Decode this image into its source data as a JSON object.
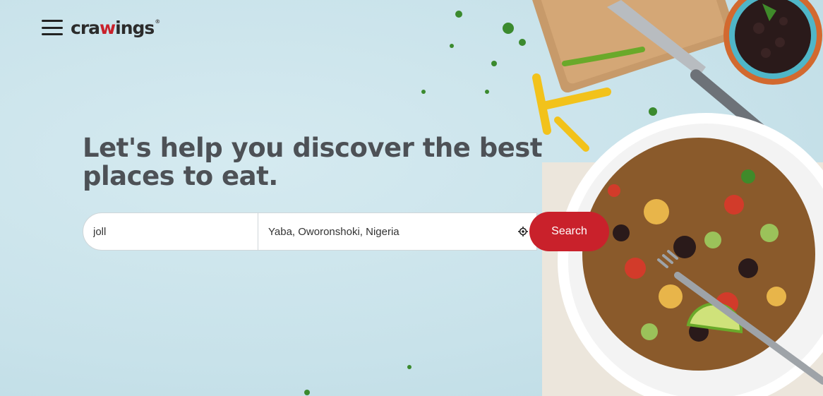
{
  "header": {
    "logo_prefix": "cra",
    "logo_accent": "w",
    "logo_suffix": "ings",
    "logo_mark": "®"
  },
  "hero": {
    "headline": "Let's help you discover the best places to eat."
  },
  "search": {
    "food_value": "joll",
    "location_value": "Yaba, Oworonshoki, Nigeria",
    "button_label": "Search"
  },
  "colors": {
    "accent": "#c9212b",
    "background": "#cfe6ec",
    "headline": "#4d5156"
  }
}
